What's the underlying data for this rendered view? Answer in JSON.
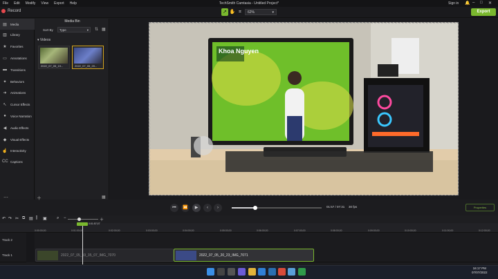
{
  "menu": [
    "File",
    "Edit",
    "Modify",
    "View",
    "Export",
    "Help"
  ],
  "window_title": "TechSmith Camtasia - Untitled Project*",
  "signin": "Sign in",
  "record_label": "Record",
  "zoom": "62%",
  "export_label": "Export",
  "sidebar": [
    {
      "label": "Media",
      "icon": "film-icon"
    },
    {
      "label": "Library",
      "icon": "library-icon"
    },
    {
      "label": "Favorites",
      "icon": "star-icon"
    },
    {
      "label": "Annotations",
      "icon": "annotation-icon"
    },
    {
      "label": "Transitions",
      "icon": "transition-icon"
    },
    {
      "label": "Behaviors",
      "icon": "behavior-icon"
    },
    {
      "label": "Animations",
      "icon": "animation-icon"
    },
    {
      "label": "Cursor Effects",
      "icon": "cursor-icon"
    },
    {
      "label": "Voice Narration",
      "icon": "microphone-icon"
    },
    {
      "label": "Audio Effects",
      "icon": "speaker-icon"
    },
    {
      "label": "Visual Effects",
      "icon": "visual-effects-icon"
    },
    {
      "label": "Interactivity",
      "icon": "interactivity-icon"
    },
    {
      "label": "Captions",
      "icon": "captions-icon"
    }
  ],
  "media_bin": {
    "title": "Media Bin",
    "sort_label": "Sort By",
    "sort_value": "Type",
    "section": "Videos",
    "items": [
      {
        "name": "2022_07_05_19..."
      },
      {
        "name": "2022_07_05_20..."
      }
    ]
  },
  "transport": {
    "timecode": "01:57 / 07:31",
    "fps": "30 fps",
    "progress": 0.26,
    "properties": "Properties"
  },
  "timeline": {
    "playhead": "0:01:57;07",
    "ticks": [
      "0:00:00;00",
      "0:01:00;00",
      "0:02:00;00",
      "0:03:00;00",
      "0:04:00;00",
      "0:05:00;00",
      "0:06:00;00",
      "0:07:00;00",
      "0:08:00;00",
      "0:09:00;00",
      "0:10:00;00",
      "0:11:00;00",
      "0:12:00;00"
    ],
    "tracks": [
      "Track 2",
      "Track 1"
    ],
    "clips": [
      {
        "label": "2022_07_05_19_35_07_IMG_7070"
      },
      {
        "label": "2022_07_05_20_23_IMG_7071"
      }
    ]
  },
  "clock": {
    "time": "16:17 PM",
    "date": "07/07/2022"
  },
  "preview_overlay": "Khoa Nguyen"
}
